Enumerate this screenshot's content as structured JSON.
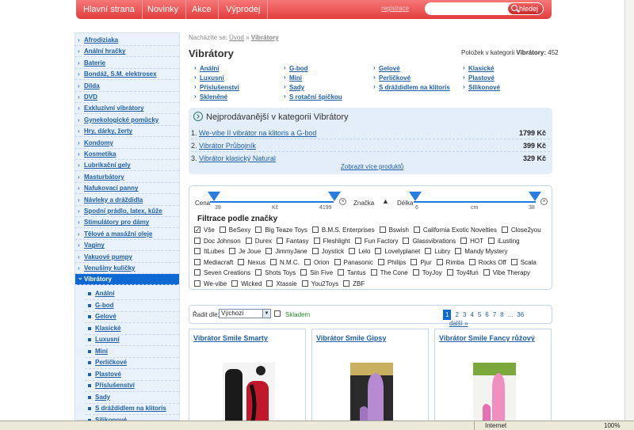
{
  "nav": {
    "items": [
      "Hlavní strana",
      "Novinky",
      "Akce",
      "Výprodej"
    ],
    "register": "registrace",
    "search_button": "hledej"
  },
  "sidebar": {
    "items": [
      "Afrodiziaka",
      "Anální hračky",
      "Baterie",
      "Bondáž, S.M. elektrosex",
      "Dilda",
      "DVD",
      "Exkluzivní vibrátory",
      "Gynekologické pomůcky",
      "Hry, dárky, žerty",
      "Kondomy",
      "Kosmetika",
      "Lubrikační gely",
      "Masturbátory",
      "Nafukovací panny",
      "Návleky a dráždidla",
      "Spodní prádlo, latex, kůže",
      "Stimulátory pro dámy",
      "Tělové a masážní oleje",
      "Vaginy",
      "Vakuové pumpy",
      "Venušiny kuličky"
    ],
    "active": "Vibrátory",
    "subitems": [
      "Anální",
      "G-bod",
      "Gelové",
      "Klasické",
      "Luxusní",
      "Mini",
      "Perličkové",
      "Plastové",
      "Příslušenství",
      "Sady",
      "S dráždidlem na klitoris",
      "Silikonové"
    ]
  },
  "breadcrumb": {
    "prefix": "Nacházíte se:",
    "home": "Úvod",
    "sep": "»",
    "current": "Vibrátory"
  },
  "page": {
    "title": "Vibrátory",
    "count_label": "Položek v kategorii",
    "count_cat": "Vibrátory:",
    "count_value": "452"
  },
  "categories": [
    [
      "Anální",
      "Luxusní",
      "Příslušenství",
      "Skleněné"
    ],
    [
      "G-bod",
      "Mini",
      "Sady",
      "S rotační špičkou"
    ],
    [
      "Gelové",
      "Perličkové",
      "S dráždidlem na klitoris"
    ],
    [
      "Klasické",
      "Plastové",
      "Silikonové"
    ]
  ],
  "bestsellers": {
    "heading": "Nejprodávanější v kategorii Vibrátory",
    "rows": [
      {
        "n": "1.",
        "name": "We-vibe II vibrátor na klitoris a G-bod",
        "price": "1799 Kč"
      },
      {
        "n": "2.",
        "name": "Vibrátor Průbojník",
        "price": "399 Kč"
      },
      {
        "n": "3.",
        "name": "Vibrátor klasický Natural",
        "price": "329 Kč"
      }
    ],
    "more": "Zobrazit více produktů"
  },
  "filter": {
    "price_label": "Cena",
    "price_min": "39",
    "price_unit": "Kč",
    "price_max": "4199",
    "brand_label": "Značka",
    "length_label": "Délka",
    "len_min": "6",
    "len_unit": "cm",
    "len_max": "38",
    "brands_title": "Filtrace podle značky",
    "brands": [
      "Vše",
      "BeSexy",
      "Big Teaze Toys",
      "B.M.S. Enterprises",
      "Bswish",
      "California Exotic Novelties",
      "Close2you",
      "Doc Johnson",
      "Durex",
      "Fantasy",
      "Fleshlight",
      "Fun Factory",
      "Glassvibrations",
      "HOT",
      "iLusting",
      "ItLubes",
      "Je Joue",
      "JimmyJane",
      "Joystick",
      "Lelo",
      "Lovelyplanet",
      "Lubry",
      "Mandy Mystery",
      "Mediacraft",
      "Nexus",
      "N.M.C.",
      "Orion",
      "Panasonic",
      "Philips",
      "Pjur",
      "Rimba",
      "Rocks Off",
      "Scala",
      "Seven Creations",
      "Shots Toys",
      "Sin Five",
      "Tantus",
      "The Cone",
      "ToyJoy",
      "Toy4fun",
      "Vibe Therapy",
      "We-vibe",
      "Wicked",
      "Xtassie",
      "You2Toys",
      "ZBF"
    ]
  },
  "sort": {
    "label": "Řadit dle:",
    "value": "Výchozí",
    "stock": "Skladem",
    "pages": [
      "1",
      "2",
      "3",
      "4",
      "5",
      "6",
      "7",
      "8",
      "...",
      "36"
    ],
    "next": "další »"
  },
  "products": [
    "Vibrátor Smile Smarty",
    "Vibrátor Smile Gipsy",
    "Vibrátor Smile Fancy růžový"
  ],
  "status": {
    "zone": "Internet",
    "zoom": "100%"
  }
}
